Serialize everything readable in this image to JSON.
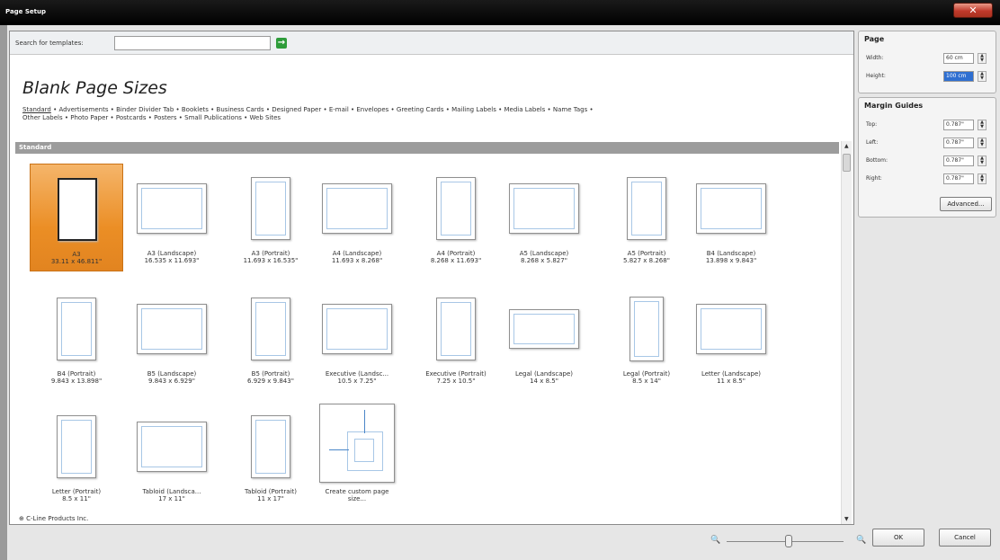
{
  "window": {
    "title": "Page Setup",
    "close_glyph": "✕"
  },
  "search": {
    "label": "Search for templates:",
    "value": "",
    "go_glyph": "→"
  },
  "heading": "Blank Page Sizes",
  "categories": {
    "line1": [
      "Standard",
      "Advertisements",
      "Binder Divider Tab",
      "Booklets",
      "Business Cards",
      "Designed Paper",
      "E-mail",
      "Envelopes",
      "Greeting Cards",
      "Mailing Labels",
      "Media Labels",
      "Name Tags"
    ],
    "line2": [
      "Other Labels",
      "Photo Paper",
      "Postcards",
      "Posters",
      "Small Publications",
      "Web Sites"
    ]
  },
  "section_title": "Standard",
  "templates": [
    {
      "name": "A3",
      "size": "33.11 x 46.811\"",
      "orient": "portrait",
      "selected": true
    },
    {
      "name": "A3 (Landscape)",
      "size": "16.535 x 11.693\"",
      "orient": "landscape"
    },
    {
      "name": "A3 (Portrait)",
      "size": "11.693 x 16.535\"",
      "orient": "portrait"
    },
    {
      "name": "A4 (Landscape)",
      "size": "11.693 x 8.268\"",
      "orient": "landscape"
    },
    {
      "name": "A4 (Portrait)",
      "size": "8.268 x 11.693\"",
      "orient": "portrait"
    },
    {
      "name": "A5 (Landscape)",
      "size": "8.268 x 5.827\"",
      "orient": "landscape"
    },
    {
      "name": "A5 (Portrait)",
      "size": "5.827 x 8.268\"",
      "orient": "portrait"
    },
    {
      "name": "B4 (Landscape)",
      "size": "13.898 x 9.843\"",
      "orient": "landscape"
    },
    {
      "name": "B4 (Portrait)",
      "size": "9.843 x 13.898\"",
      "orient": "portrait"
    },
    {
      "name": "B5 (Landscape)",
      "size": "9.843 x 6.929\"",
      "orient": "landscape"
    },
    {
      "name": "B5 (Portrait)",
      "size": "6.929 x 9.843\"",
      "orient": "portrait"
    },
    {
      "name": "Executive (Landsc...",
      "size": "10.5 x 7.25\"",
      "orient": "landscape"
    },
    {
      "name": "Executive (Portrait)",
      "size": "7.25 x 10.5\"",
      "orient": "portrait"
    },
    {
      "name": "Legal (Landscape)",
      "size": "14 x 8.5\"",
      "orient": "landscape-wide"
    },
    {
      "name": "Legal (Portrait)",
      "size": "8.5 x 14\"",
      "orient": "portrait-tall"
    },
    {
      "name": "Letter (Landscape)",
      "size": "11 x 8.5\"",
      "orient": "landscape"
    },
    {
      "name": "Letter (Portrait)",
      "size": "8.5 x 11\"",
      "orient": "portrait"
    },
    {
      "name": "Tabloid (Landsca...",
      "size": "17 x 11\"",
      "orient": "landscape"
    },
    {
      "name": "Tabloid (Portrait)",
      "size": "11 x 17\"",
      "orient": "portrait"
    },
    {
      "name": "Create custom page",
      "size": "size...",
      "orient": "custom"
    }
  ],
  "expander": {
    "glyph": "⊕",
    "label": "C-Line Products Inc."
  },
  "page_group": {
    "title": "Page",
    "width_label": "Width:",
    "width_value": "60 cm",
    "height_label": "Height:",
    "height_value": "100 cm"
  },
  "margin_group": {
    "title": "Margin Guides",
    "rows": [
      {
        "label": "Top:",
        "value": "0.787\""
      },
      {
        "label": "Left:",
        "value": "0.787\""
      },
      {
        "label": "Bottom:",
        "value": "0.787\""
      },
      {
        "label": "Right:",
        "value": "0.787\""
      }
    ],
    "advanced_label": "Advanced..."
  },
  "buttons": {
    "ok": "OK",
    "cancel": "Cancel"
  },
  "zoom": {
    "out_glyph": "🔍",
    "in_glyph": "🔍",
    "level": 0.53
  },
  "colors": {
    "selected_tile": "#eb8e25",
    "highlight_field": "#2f6fd1",
    "section_bar": "#9c9c9c"
  }
}
